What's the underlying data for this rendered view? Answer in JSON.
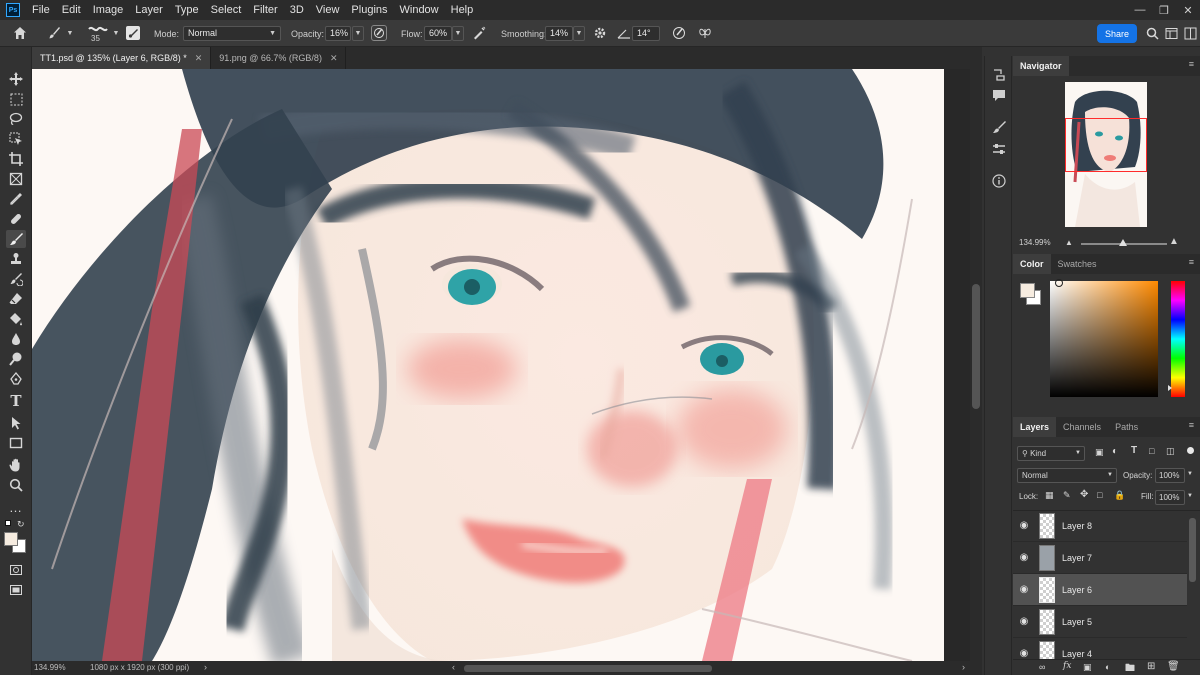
{
  "menubar": {
    "logo": "Ps",
    "items": [
      "File",
      "Edit",
      "Image",
      "Layer",
      "Type",
      "Select",
      "Filter",
      "3D",
      "View",
      "Plugins",
      "Window",
      "Help"
    ],
    "window_controls": [
      "minimize-icon",
      "restore-icon",
      "close-icon"
    ]
  },
  "options": {
    "brush_size": "35",
    "mode_label": "Mode:",
    "mode_value": "Normal",
    "opacity_label": "Opacity:",
    "opacity_value": "16%",
    "flow_label": "Flow:",
    "flow_value": "60%",
    "smoothing_label": "Smoothing:",
    "smoothing_value": "14%",
    "angle_value": "14°",
    "share_label": "Share"
  },
  "tabs": [
    {
      "label": "TT1.psd @ 135% (Layer 6, RGB/8) *",
      "active": true
    },
    {
      "label": "91.png @ 66.7% (RGB/8)",
      "active": false
    }
  ],
  "status": {
    "zoom": "134.99%",
    "doc_info": "1080 px x 1920 px (300 ppi)"
  },
  "navigator": {
    "title": "Navigator",
    "zoom": "134.99%"
  },
  "color_panel": {
    "tabs": [
      "Color",
      "Swatches"
    ],
    "foreground": "#f6ece0",
    "background": "#ffffff"
  },
  "layers_panel": {
    "tabs": [
      "Layers",
      "Channels",
      "Paths"
    ],
    "filter_kind": "Kind",
    "blend_mode": "Normal",
    "opacity_label": "Opacity:",
    "opacity_value": "100%",
    "lock_label": "Lock:",
    "fill_label": "Fill:",
    "fill_value": "100%",
    "layers": [
      {
        "name": "Layer 8",
        "visible": true,
        "selected": false
      },
      {
        "name": "Layer 7",
        "visible": true,
        "selected": false
      },
      {
        "name": "Layer 6",
        "visible": true,
        "selected": true
      },
      {
        "name": "Layer 5",
        "visible": true,
        "selected": false
      },
      {
        "name": "Layer 4",
        "visible": true,
        "selected": false
      }
    ]
  }
}
